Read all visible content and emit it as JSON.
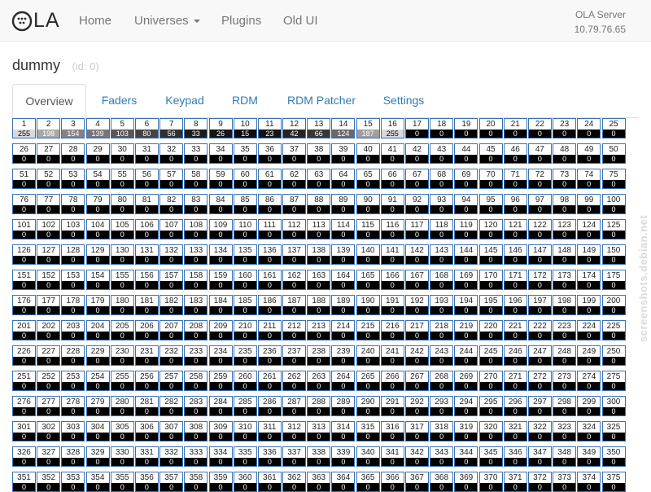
{
  "navbar": {
    "brand": "OLA",
    "links": {
      "home": "Home",
      "universes": "Universes",
      "plugins": "Plugins",
      "old_ui": "Old UI"
    },
    "server": {
      "name": "OLA Server",
      "ip": "10.79.76.65"
    }
  },
  "universe": {
    "name": "dummy",
    "id_label": "(id: 0)"
  },
  "tabs": {
    "overview": "Overview",
    "faders": "Faders",
    "keypad": "Keypad",
    "rdm": "RDM",
    "rdm_patcher": "RDM Patcher",
    "settings": "Settings"
  },
  "dmx": {
    "visible_channels": 375,
    "nonzero_values": {
      "1": 255,
      "2": 198,
      "3": 154,
      "4": 139,
      "5": 103,
      "6": 80,
      "7": 56,
      "8": 33,
      "9": 26,
      "10": 15,
      "11": 23,
      "12": 42,
      "13": 66,
      "14": 124,
      "15": 187,
      "16": 255
    },
    "default_value": 0
  },
  "watermark": "screenshots.debian.net",
  "colors": {
    "navbar_bg": "#f8f8f8",
    "link_blue": "#337ab7",
    "cell_border": "#3a72b5",
    "value_bg": "#000000",
    "value_text": "#ffffff"
  }
}
